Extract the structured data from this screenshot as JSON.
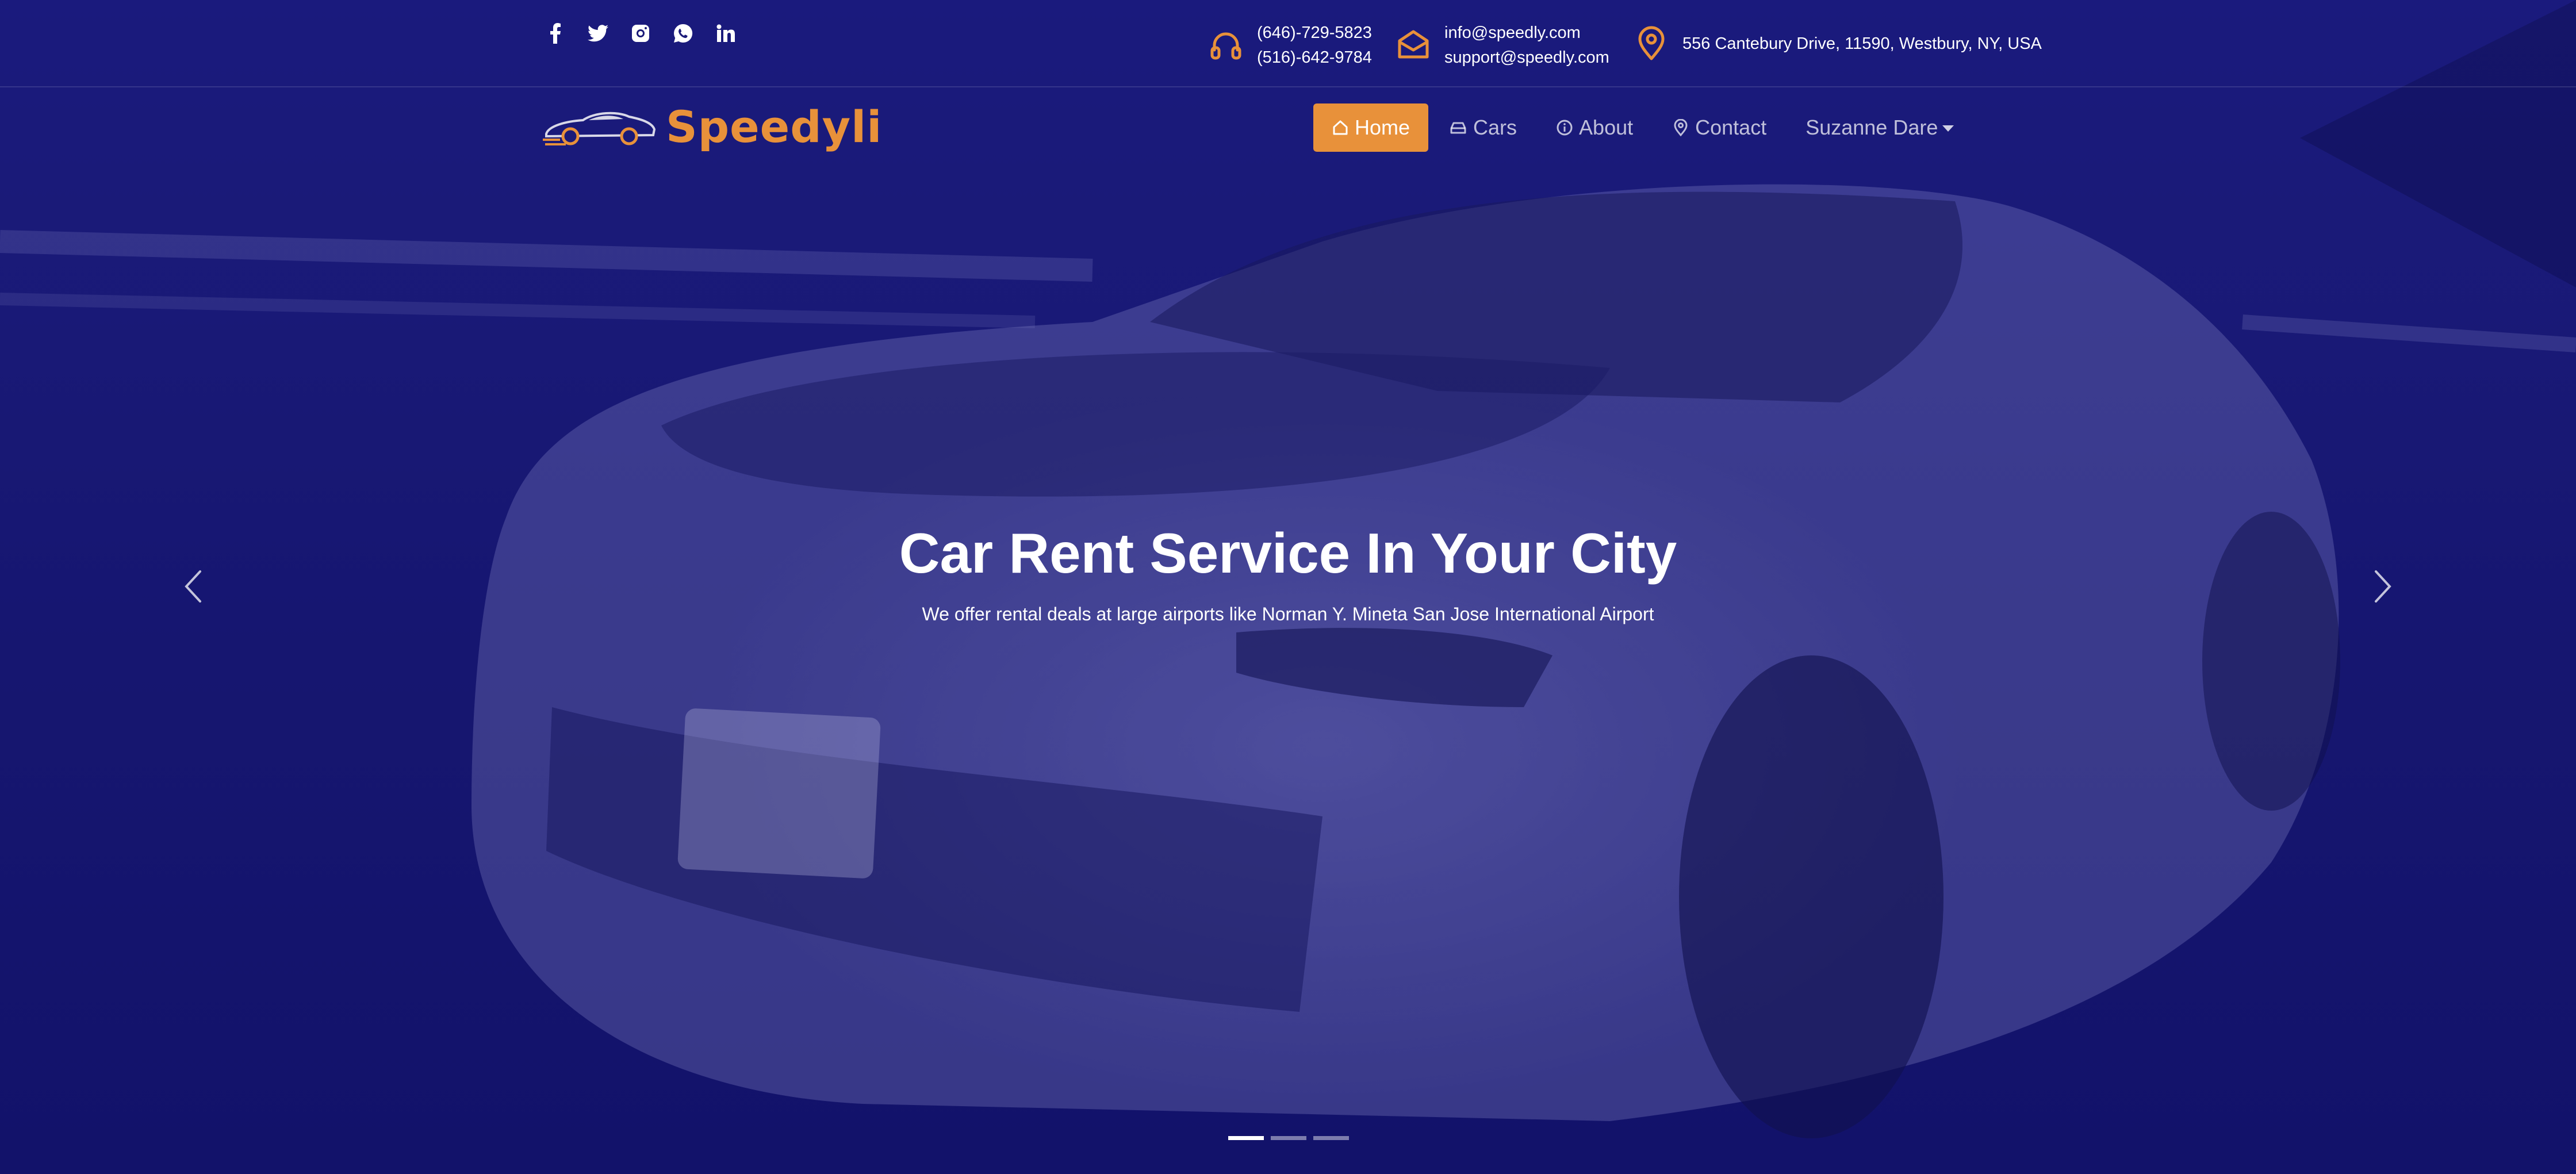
{
  "colors": {
    "accent": "#e8913a",
    "background": "#16166e",
    "text": "#ffffff"
  },
  "social": [
    {
      "name": "facebook-icon"
    },
    {
      "name": "twitter-icon"
    },
    {
      "name": "instagram-icon"
    },
    {
      "name": "whatsapp-icon"
    },
    {
      "name": "linkedin-icon"
    }
  ],
  "contact": {
    "phone1": "(646)-729-5823",
    "phone2": "(516)-642-9784",
    "email1": "info@speedly.com",
    "email2": "support@speedly.com",
    "address": "556 Cantebury Drive, 11590, Westbury, NY, USA"
  },
  "brand": {
    "name": "Speedyli"
  },
  "nav": {
    "home": "Home",
    "cars": "Cars",
    "about": "About",
    "contact": "Contact",
    "user": "Suzanne Dare"
  },
  "hero": {
    "title": "Car Rent Service In Your City",
    "subtitle": "We offer rental deals at large airports like Norman Y. Mineta San Jose International Airport",
    "slides_total": 3,
    "active_slide": 1
  }
}
